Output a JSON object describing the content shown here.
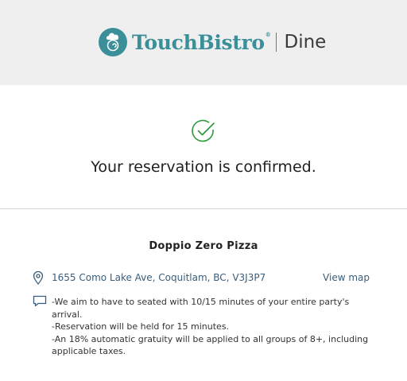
{
  "header": {
    "brand_name": "TouchBistro",
    "brand_reg": "®",
    "product": "Dine"
  },
  "confirmation": {
    "message": "Your reservation is confirmed."
  },
  "restaurant": {
    "name": "Doppio Zero Pizza",
    "address": "1655 Como Lake Ave, Coquitlam, BC, V3J3P7",
    "view_map_label": "View map",
    "notes": [
      "-We aim to have to seated with 10/15 minutes of your entire party's arrival.",
      "-Reservation will be held for 15 minutes.",
      "-An 18% automatic gratuity will be applied to all groups of 8+, including applicable taxes."
    ]
  },
  "colors": {
    "brand": "#3a8f99",
    "success": "#2e9a3e",
    "link": "#3a5d7c",
    "header_bg": "#efefef"
  }
}
